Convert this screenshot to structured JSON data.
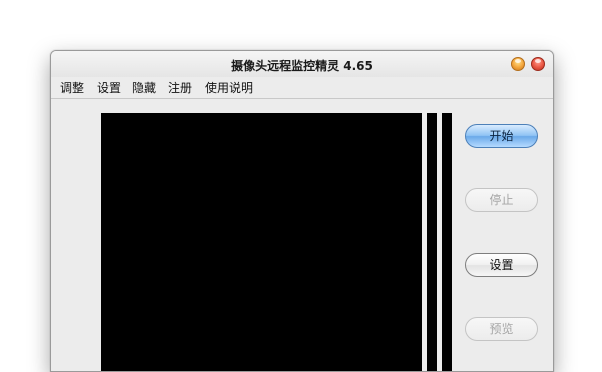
{
  "window": {
    "title": "摄像头远程监控精灵  4.65"
  },
  "menu": {
    "items": [
      {
        "label": "调整"
      },
      {
        "label": "设置"
      },
      {
        "label": "隐藏"
      },
      {
        "label": "注册"
      },
      {
        "label": "使用说明"
      }
    ]
  },
  "controls": {
    "start_label": "开始",
    "stop_label": "停止",
    "settings_label": "设置",
    "preview_label": "预览"
  },
  "colors": {
    "preview_background": "#000000",
    "primary_button": "#8fc3f4"
  }
}
